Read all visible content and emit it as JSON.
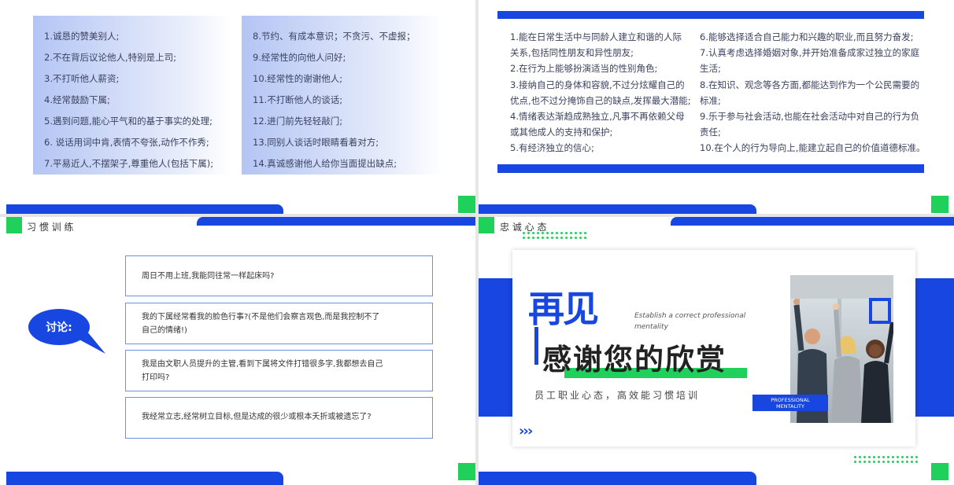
{
  "slide1": {
    "left_items": [
      "1.诚恳的赞美别人;",
      "2.不在背后议论他人,特别是上司;",
      "3.不打听他人薪资;",
      "4.经常鼓励下属;",
      "5.遇到问题,能心平气和的基于事实的处理;",
      "6. 说话用词中肯,表情不夸张,动作不作秀;",
      "7.平易近人,不摆架子,尊重他人(包括下属);"
    ],
    "right_items": [
      "8.节约、有成本意识；不贪污、不虚报；",
      "9.经常性的向他人问好;",
      "10.经常性的谢谢他人;",
      "11.不打断他人的谈话;",
      "12.进门前先轻轻敲门;",
      "13.同别人谈话时眼睛看着对方;",
      "14.真诚感谢他人给你当面提出缺点;"
    ]
  },
  "slide2": {
    "left_lines": [
      "1.能在日常生活中与同龄人建立和谐的人际",
      "关系,包括同性朋友和异性朋友;",
      "2.在行为上能够扮演适当的性别角色;",
      "3.接纳自己的身体和容貌,不过分炫耀自己的",
      "优点,也不过分掩饰自己的缺点,发挥最大潜能;",
      "4.情绪表达渐趋成熟独立,凡事不再依赖父母",
      "或其他成人的支持和保护;",
      "5.有经济独立的信心;"
    ],
    "right_lines": [
      "6.能够选择适合自己能力和兴趣的职业,而且努力奋发;",
      "7.认真考虑选择婚姻对象,并开始准备成家过独立的家庭",
      "生活;",
      "8.在知识、观念等各方面,都能达到作为一个公民需要的",
      "标准;",
      "9.乐于参与社会活动,也能在社会活动中对自己的行为负",
      "责任;",
      "10.在个人的行为导向上,能建立起自己的价值道德标准。"
    ]
  },
  "slide3": {
    "title": "习 惯 训 练",
    "bubble": "讨论:",
    "questions": [
      "周日不用上班,我能同往常一样起床吗?",
      "我的下属经常看我的脸色行事?(不是他们会察言观色,而是我控制不了|自己的情绪!)",
      "我是由文职人员提升的主管,看到下属将文件打错很多字,我都想去自己|打印吗?",
      "我经常立志,经常树立目标,但是达成的很少或根本夭折或被遗忘了?"
    ]
  },
  "slide4": {
    "title": "忠 诚 心 态",
    "big_title": "再见",
    "english_line1": "Establish a correct professional",
    "english_line2": "mentality",
    "thanks": "感谢您的欣赏",
    "subtitle": "员工职业心态，高效能习惯培训",
    "badge_line1": "PROFESSIONAL",
    "badge_line2": "MENTALITY",
    "arrows": "›››"
  },
  "colors": {
    "accent_blue": "#1746e0",
    "accent_green": "#1fd15a"
  }
}
